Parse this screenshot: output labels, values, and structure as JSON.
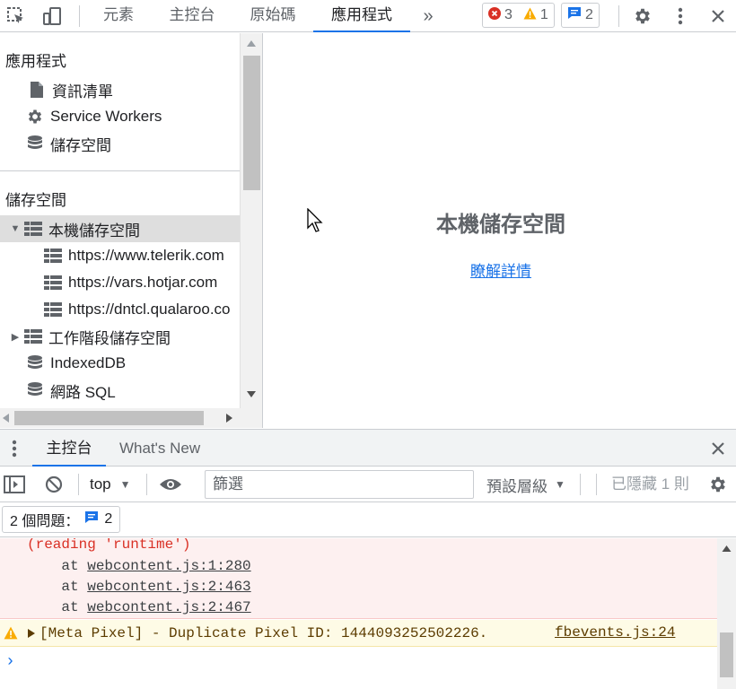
{
  "toolbar": {
    "tabs": [
      {
        "label": "元素"
      },
      {
        "label": "主控台"
      },
      {
        "label": "原始碼"
      },
      {
        "label": "應用程式"
      }
    ],
    "errors": "3",
    "warnings": "1",
    "messages": "2",
    "icons": [
      "inspect-icon",
      "device-toggle-icon",
      "more-tabs-icon",
      "error-icon",
      "warning-icon",
      "message-icon",
      "settings-icon",
      "kebab-menu-icon",
      "close-icon"
    ]
  },
  "sidebar": {
    "section1_title": "應用程式",
    "app_items": [
      {
        "label": "資訊清單",
        "icon": "file-icon"
      },
      {
        "label": "Service Workers",
        "icon": "gear-icon"
      },
      {
        "label": "儲存空間",
        "icon": "database-icon"
      }
    ],
    "section2_title": "儲存空間",
    "storage_items": [
      {
        "label": "本機儲存空間",
        "icon": "table-icon",
        "expanded": true,
        "selected": true
      },
      {
        "label": "https://www.telerik.com",
        "icon": "table-icon"
      },
      {
        "label": "https://vars.hotjar.com",
        "icon": "table-icon"
      },
      {
        "label": "https://dntcl.qualaroo.co",
        "icon": "table-icon"
      },
      {
        "label": "工作階段儲存空間",
        "icon": "table-icon",
        "expanded": false
      },
      {
        "label": "IndexedDB",
        "icon": "database-icon"
      },
      {
        "label": "網路 SQL",
        "icon": "database-icon"
      }
    ]
  },
  "main": {
    "title": "本機儲存空間",
    "link": "瞭解詳情"
  },
  "drawer": {
    "tabs": [
      {
        "label": "主控台"
      },
      {
        "label": "What's New"
      }
    ]
  },
  "console_toolbar": {
    "context": "top",
    "filter_placeholder": "篩選",
    "levels": "預設層級",
    "hidden": "已隱藏 1 則"
  },
  "issues": {
    "label": "2 個問題：",
    "count": "2"
  },
  "console": {
    "error_lines": [
      "(reading 'runtime')"
    ],
    "stack": [
      {
        "prefix": "    at ",
        "link": "webcontent.js:1:280"
      },
      {
        "prefix": "    at ",
        "link": "webcontent.js:2:463"
      },
      {
        "prefix": "    at ",
        "link": "webcontent.js:2:467"
      }
    ],
    "warning": "[Meta Pixel] - Duplicate Pixel ID: 1444093252502226.",
    "warning_source": "fbevents.js:24",
    "prompt": "›"
  },
  "colors": {
    "accent": "#1a73e8",
    "error": "#d93025",
    "warning": "#f9ab00"
  }
}
